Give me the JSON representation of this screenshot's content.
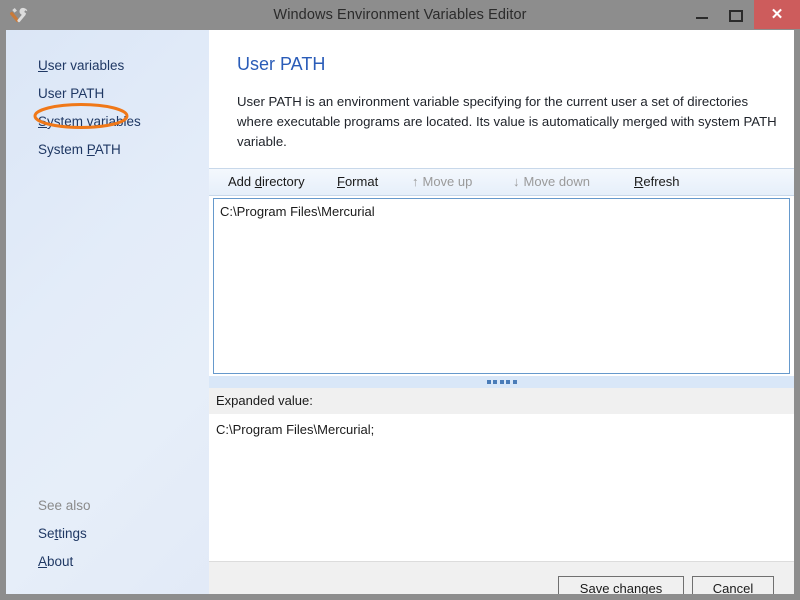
{
  "window": {
    "title": "Windows Environment Variables Editor",
    "app_icon": "tools-wrench-screwdriver-icon",
    "controls": {
      "minimize": "minimize-icon",
      "maximize": "maximize-icon",
      "close": "✕"
    },
    "close_button_color": "#cd5c5c",
    "titlebar_color": "#8d8d8d"
  },
  "sidebar": {
    "background_gradient": [
      "#dbe6f6",
      "#e6eef9"
    ],
    "items": [
      {
        "label": "User variables",
        "accel": "U",
        "selected": false
      },
      {
        "label": "User PATH",
        "accel": "",
        "selected": true
      },
      {
        "label": "System variables",
        "accel": "S",
        "selected": false
      },
      {
        "label": "System PATH",
        "accel": "P",
        "selected": false
      }
    ],
    "see_also": {
      "header": "See also",
      "items": [
        {
          "label": "Settings",
          "accel": "t"
        },
        {
          "label": "About",
          "accel": "A"
        }
      ]
    },
    "annotation": {
      "shape": "ellipse",
      "color": "#f07818",
      "target": "User PATH"
    }
  },
  "content": {
    "title": "User PATH",
    "title_color": "#2a5cb8",
    "description": "User PATH is an environment variable specifying for the current user a set of directories where executable programs are located. Its value is automatically merged with system PATH variable."
  },
  "toolbar": {
    "items": [
      {
        "label": "Add directory",
        "accel": "d",
        "icon": "",
        "disabled": false
      },
      {
        "label": "Format",
        "accel": "F",
        "icon": "",
        "disabled": false
      },
      {
        "label": "Move up",
        "accel": "",
        "icon": "↑",
        "disabled": true
      },
      {
        "label": "Move down",
        "accel": "",
        "icon": "↓",
        "disabled": true
      },
      {
        "label": "Refresh",
        "accel": "R",
        "icon": "",
        "disabled": false
      }
    ]
  },
  "directory_list": {
    "border_color": "#6699cc",
    "entries": [
      "C:\\Program Files\\Mercurial"
    ]
  },
  "splitter": {
    "grip_dots": 5,
    "color": "#d9e7f8"
  },
  "expanded": {
    "header_label": "Expanded value:",
    "value": "C:\\Program Files\\Mercurial;"
  },
  "footer": {
    "save_label": "Save changes",
    "save_accel": "S",
    "cancel_label": "Cancel"
  }
}
